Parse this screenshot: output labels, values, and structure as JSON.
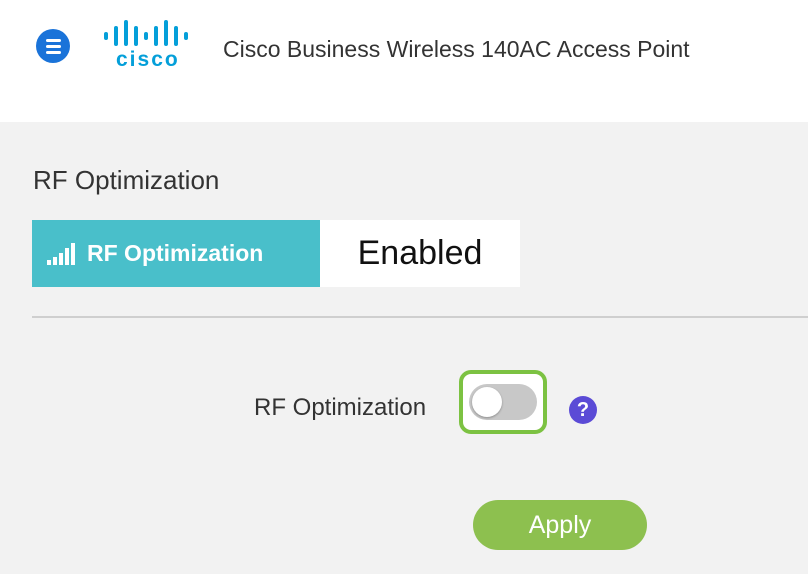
{
  "header": {
    "logo_text": "cisco",
    "title": "Cisco Business Wireless 140AC Access Point",
    "menu_icon": "hamburger-menu-icon"
  },
  "panel": {
    "section_title": "RF Optimization",
    "status_card": {
      "label": "RF Optimization",
      "value": "Enabled",
      "icon": "signal-bars-icon"
    },
    "field": {
      "label": "RF Optimization",
      "toggle_state": "off"
    },
    "help_icon_text": "?",
    "apply_label": "Apply"
  },
  "colors": {
    "menu_blue": "#1a73d9",
    "cisco_blue": "#049fd9",
    "status_teal": "#49bfca",
    "highlight_green": "#7cc242",
    "apply_green": "#8dc04f",
    "help_purple": "#5b4bd6",
    "panel_bg": "#f2f2f2"
  }
}
